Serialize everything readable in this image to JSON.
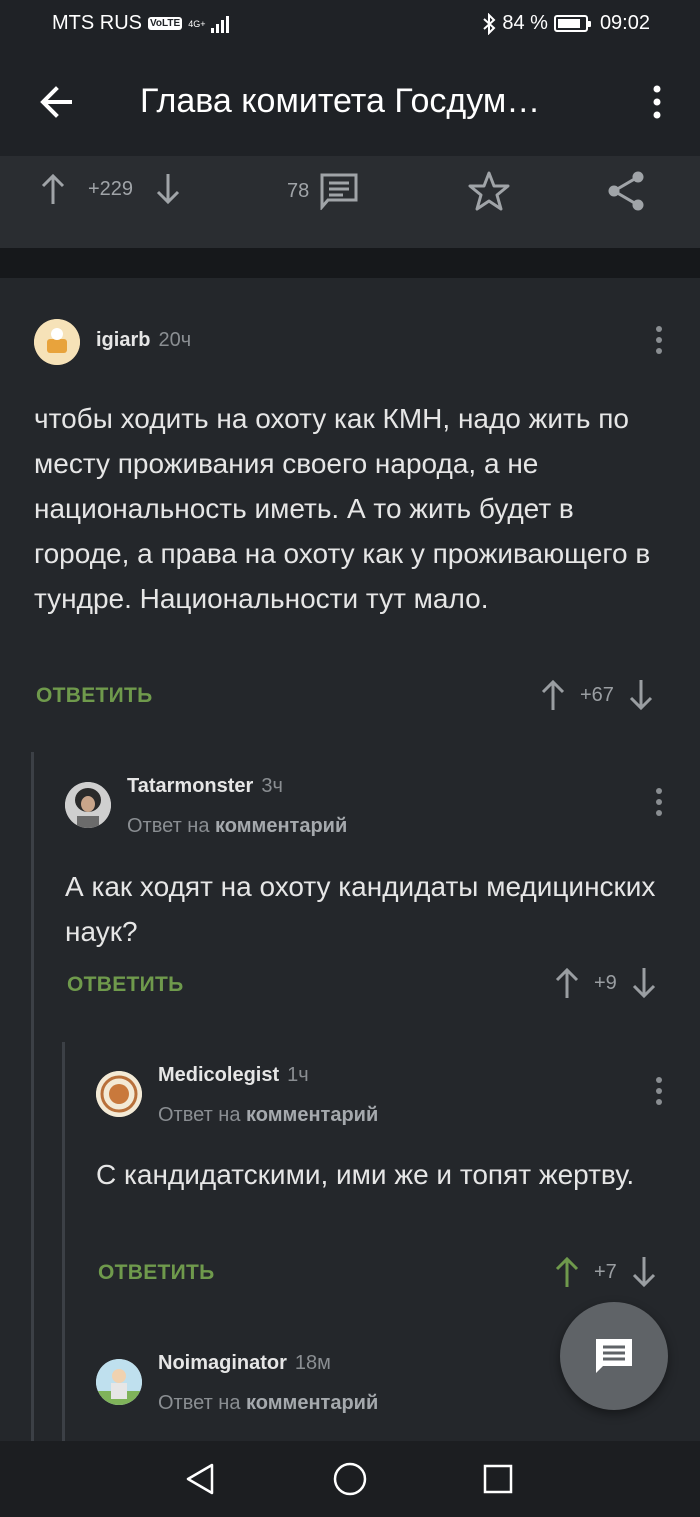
{
  "status_bar": {
    "carrier": "MTS RUS",
    "volte": "VoLTE",
    "network": "4G+",
    "bluetooth_icon": "bluetooth-icon",
    "battery_percent": "84 %",
    "battery_level": 84,
    "time": "09:02"
  },
  "app_bar": {
    "title": "Глава комитета Госдум…",
    "back_icon": "arrow-left-icon",
    "menu_icon": "more-vert-icon"
  },
  "post_actions": {
    "rating": "+229",
    "comments_count": "78",
    "upvote_icon": "arrow-up-icon",
    "downvote_icon": "arrow-down-icon",
    "comments_icon": "comment-icon",
    "save_icon": "star-icon",
    "share_icon": "share-icon"
  },
  "comments": [
    {
      "author": "igiarb",
      "time": "20ч",
      "reply_to": "",
      "text": "чтобы ходить на охоту как КМН, надо жить по месту проживания своего народа, а не национальность иметь. А то жить будет в городе, а права на охоту как у проживающего в тундре. Национальности тут мало.",
      "reply_label": "ОТВЕТИТЬ",
      "rating": "+67",
      "upvoted": false
    },
    {
      "author": "Tatarmonster",
      "time": "3ч",
      "reply_to_prefix": "Ответ на",
      "reply_to": "комментарий",
      "text": "А как ходят на охоту кандидаты медицинских наук?",
      "reply_label": "ОТВЕТИТЬ",
      "rating": "+9",
      "upvoted": false
    },
    {
      "author": "Medicolegist",
      "time": "1ч",
      "reply_to_prefix": "Ответ на",
      "reply_to": "комментарий",
      "text": "С кандидатскими, ими же и топят жертву.",
      "reply_label": "ОТВЕТИТЬ",
      "rating": "+7",
      "upvoted": true
    },
    {
      "author": "Noimaginator",
      "time": "18м",
      "reply_to_prefix": "Ответ на",
      "reply_to": "комментарий",
      "text": "",
      "reply_label": "",
      "rating": "",
      "upvoted": false
    }
  ],
  "colors": {
    "background": "#24272b",
    "accent_green": "#6f9a4c",
    "muted": "#9a9ea2"
  },
  "fab_icon": "new-comment-icon",
  "nav": {
    "back_icon": "nav-back-triangle-icon",
    "home_icon": "nav-home-circle-icon",
    "recents_icon": "nav-recents-square-icon"
  }
}
